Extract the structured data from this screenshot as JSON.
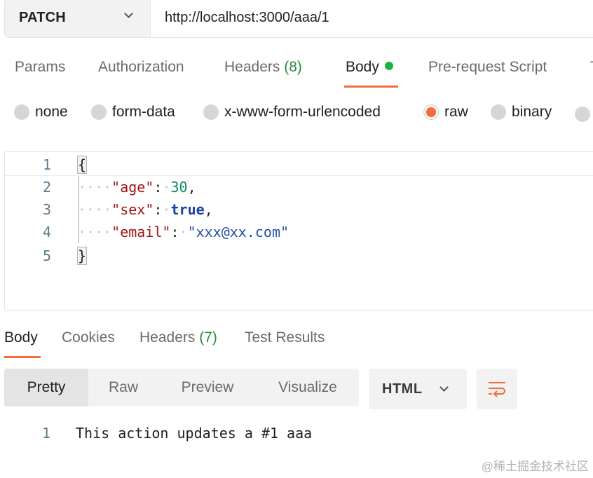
{
  "request": {
    "method": "PATCH",
    "url": "http://localhost:3000/aaa/1"
  },
  "request_tabs": [
    {
      "label": "Params"
    },
    {
      "label": "Authorization"
    },
    {
      "label": "Headers",
      "count": "(8)"
    },
    {
      "label": "Body",
      "active": true,
      "indicator": "green-dot"
    },
    {
      "label": "Pre-request Script"
    }
  ],
  "body_types": [
    {
      "label": "none"
    },
    {
      "label": "form-data"
    },
    {
      "label": "x-www-form-urlencoded"
    },
    {
      "label": "raw",
      "selected": true
    },
    {
      "label": "binary"
    }
  ],
  "editor": {
    "line_numbers": [
      "1",
      "2",
      "3",
      "4",
      "5"
    ],
    "lines": {
      "open_brace": "{",
      "age_key": "\"age\"",
      "age_value": "30",
      "sex_key": "\"sex\"",
      "sex_value": "true",
      "email_key": "\"email\"",
      "email_value": "\"xxx@xx.com\"",
      "close_brace": "}"
    },
    "punct": {
      "colon": ":",
      "comma": ",",
      "dots4": "····",
      "dot": "·"
    }
  },
  "response_tabs": [
    {
      "label": "Body",
      "active": true
    },
    {
      "label": "Cookies"
    },
    {
      "label": "Headers",
      "count": "(7)"
    },
    {
      "label": "Test Results"
    }
  ],
  "view_modes": [
    "Pretty",
    "Raw",
    "Preview",
    "Visualize"
  ],
  "active_view": "Pretty",
  "format": "HTML",
  "response_body": {
    "line_number": "1",
    "text": "This action updates a #1 aaa"
  },
  "watermark": "@稀土掘金技术社区",
  "colors": {
    "accent": "#f26b3a",
    "active_dot": "#19b341",
    "count": "#2a8a3e"
  },
  "icons": {
    "method_dropdown": "chevron-down-icon",
    "format_dropdown": "chevron-down-icon",
    "wrap": "wrap-lines-icon"
  }
}
